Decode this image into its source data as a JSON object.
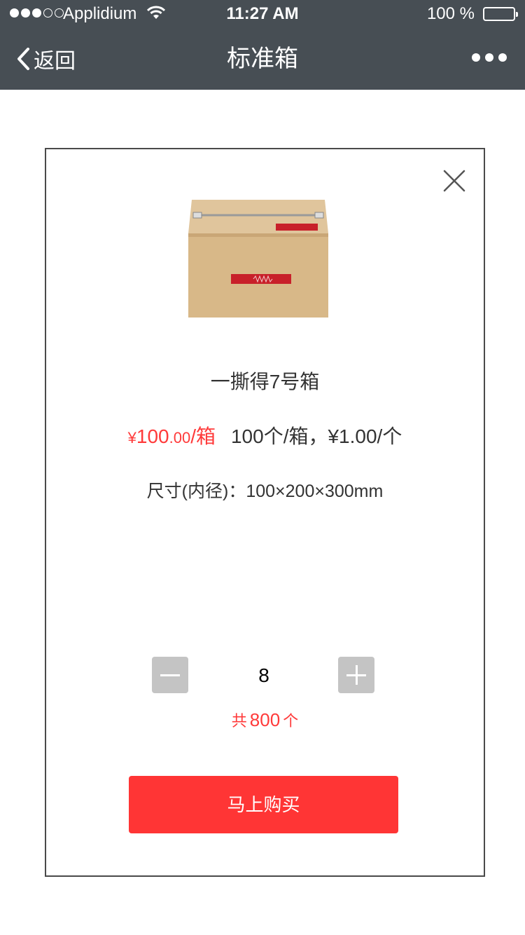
{
  "status_bar": {
    "carrier": "Applidium",
    "time": "11:27 AM",
    "battery_pct": "100 %",
    "signal_bars_filled": 3,
    "signal_bars_total": 5
  },
  "nav": {
    "back_label": "返回",
    "title": "标准箱",
    "back_icon": "chevron-left-icon",
    "more_icon": "more-dots-icon"
  },
  "product": {
    "image": "cardboard-box-image",
    "name": "一撕得7号箱",
    "price_currency": "¥",
    "price_int": "100",
    "price_dec": ".00",
    "price_unit": "/箱",
    "unit_info": "100个/箱，¥1.00/个",
    "size": "尺寸(内径)：100×200×300mm"
  },
  "quantity": {
    "value": "8",
    "total_prefix": "共",
    "total_num": "800",
    "total_suffix": "个"
  },
  "actions": {
    "buy_label": "马上购买"
  },
  "colors": {
    "nav_bg": "#474e54",
    "accent_red": "#ff3535",
    "stepper_gray": "#c4c4c4"
  }
}
